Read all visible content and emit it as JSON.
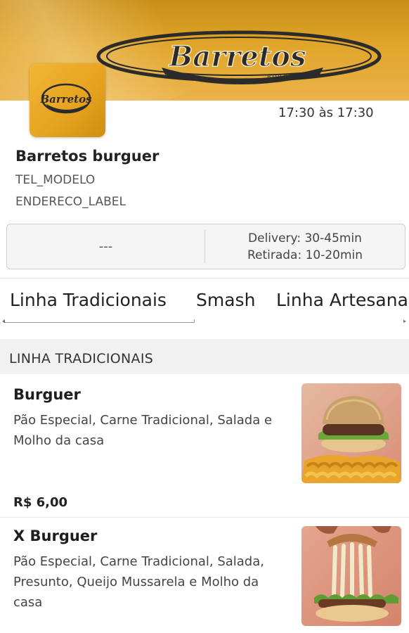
{
  "store": {
    "banner_logo_text": "Barretos",
    "banner_logo_subtext": "BURGUER",
    "thumbnail_text": "Barretos",
    "hours": "17:30 às 17:30",
    "name": "Barretos burguer",
    "phone": "TEL_MODELO",
    "address": "ENDERECO_LABEL"
  },
  "info": {
    "status": "---",
    "delivery": "Delivery: 30-45min",
    "pickup": "Retirada: 10-20min"
  },
  "tabs": [
    {
      "label": "Linha Tradicionais"
    },
    {
      "label": "Smash"
    },
    {
      "label": "Linha Artesanais"
    }
  ],
  "section": {
    "title": "LINHA TRADICIONAIS"
  },
  "items": [
    {
      "name": "Burguer",
      "description": "Pão Especial, Carne Tradicional, Salada e Molho da casa",
      "price": "R$ 6,00"
    },
    {
      "name": "X Burguer",
      "description": "Pão Especial, Carne Tradicional, Salada, Presunto, Queijo Mussarela e Molho da casa"
    }
  ],
  "colors": {
    "banner": "#e0a52a",
    "logo_dark": "#2b2b2b",
    "section_bg": "#f1f1f1"
  }
}
